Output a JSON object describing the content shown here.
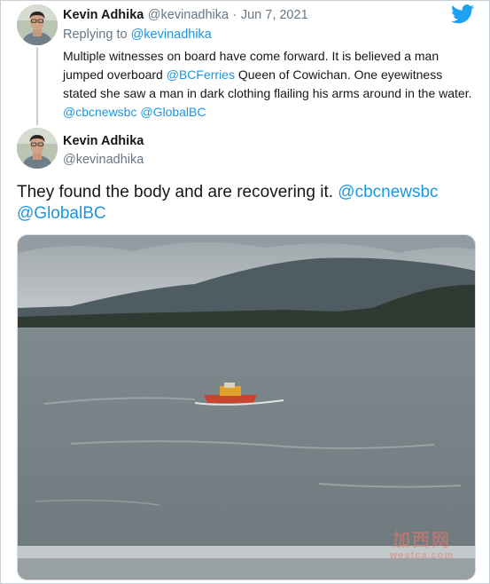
{
  "tweet_reply": {
    "author_name": "Kevin Adhika",
    "author_handle": "@kevinadhika",
    "separator": "·",
    "date": "Jun 7, 2021",
    "replying_prefix": "Replying to",
    "replying_handle": "@kevinadhika",
    "text_part1": "Multiple witnesses on board have come forward. It is believed a man jumped overboard ",
    "mention_bcferries": "@BCFerries",
    "text_part2": " Queen of Cowichan. One eyewitness stated she saw a man in dark clothing flailing his arms around in the water. ",
    "mention_cbc": "@cbcnewsbc",
    "mention_global": "@GlobalBC"
  },
  "tweet_main": {
    "author_name": "Kevin Adhika",
    "author_handle": "@kevinadhika",
    "text": "They found the body and are recovering it. ",
    "mention_cbc": "@cbcnewsbc",
    "mention_global": "@GlobalBC"
  },
  "icons": {
    "logo": "twitter-bird-icon",
    "avatar": "avatar"
  },
  "watermark": {
    "line1": "加西网",
    "line2": "westca.com"
  },
  "colors": {
    "link": "#1b95e0",
    "muted": "#657786",
    "twitter_blue": "#1da1f2"
  }
}
